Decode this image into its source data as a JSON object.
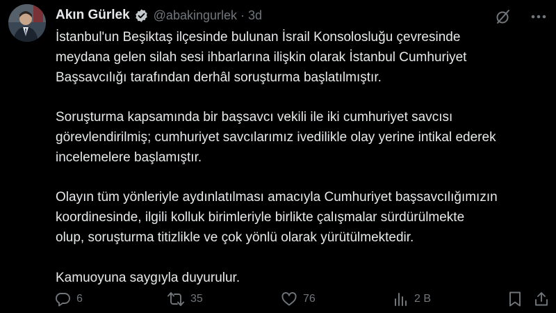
{
  "author": {
    "name": "Akın Gürlek",
    "handle": "@abakingurlek",
    "separator": "·",
    "time": "3d",
    "verified_color": "#c4c9cc"
  },
  "icons": {
    "grok": "grok-slash-circle-icon",
    "more": "more-dots-icon",
    "reply": "reply-bubble-icon",
    "retweet": "retweet-arrows-icon",
    "like": "heart-icon",
    "views": "analytics-bars-icon",
    "bookmark": "bookmark-icon",
    "share": "share-upload-icon"
  },
  "post": {
    "paragraphs": [
      [
        "İstanbul'un Beşiktaş ilçesinde bulunan İsrail Konsolosluğu çevresinde",
        "meydana gelen silah sesi ihbarlarına ilişkin olarak İstanbul Cumhuriyet",
        "Başsavcılığı tarafından derhâl soruşturma başlatılmıştır."
      ],
      [
        "Soruşturma kapsamında bir başsavcı vekili ile iki cumhuriyet savcısı",
        "görevlendirilmiş; cumhuriyet savcılarımız ivedilikle olay yerine intikal ederek",
        "incelemelere başlamıştır."
      ],
      [
        "Olayın tüm yönleriyle aydınlatılması amacıyla Cumhuriyet başsavcılığımızın",
        "koordinesinde, ilgili kolluk birimleriyle birlikte çalışmalar sürdürülmekte",
        "olup, soruşturma titizlikle ve çok yönlü olarak yürütülmektedir."
      ],
      [
        "Kamuoyuna saygıyla duyurulur."
      ]
    ]
  },
  "stats": {
    "replies": "6",
    "reposts": "35",
    "likes": "76",
    "views": "2 B"
  },
  "colors": {
    "background": "#000000",
    "text": "#e7e9ea",
    "muted": "#71767b"
  }
}
